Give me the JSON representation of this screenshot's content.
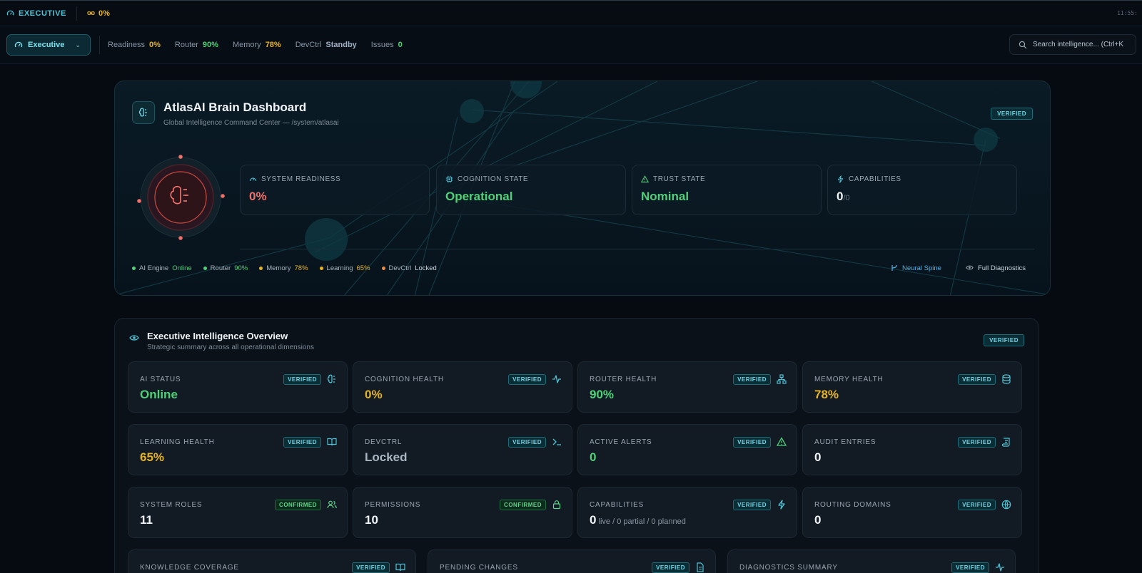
{
  "topbar": {
    "brand": "EXECUTIVE",
    "readiness": "0%",
    "clock": "11:55:"
  },
  "toolbar": {
    "mode_label": "Executive",
    "stats": [
      {
        "label": "Readiness",
        "value": "0%",
        "color": "#e6b422"
      },
      {
        "label": "Router",
        "value": "90%",
        "color": "#4fd17a"
      },
      {
        "label": "Memory",
        "value": "78%",
        "color": "#e6b422"
      },
      {
        "label": "DevCtrl",
        "value": "Standby",
        "color": "#9fb0c4"
      },
      {
        "label": "Issues",
        "value": "0",
        "color": "#4fd17a"
      }
    ],
    "search_placeholder": "Search intelligence... (Ctrl+K"
  },
  "hero": {
    "title": "AtlasAI Brain Dashboard",
    "subtitle": "Global Intelligence Command Center — /system/atlasai",
    "badge": "VERIFIED",
    "cards": [
      {
        "label": "SYSTEM READINESS",
        "value": "0%",
        "suffix": "",
        "color": "#f0706a",
        "icon": "gauge-icon"
      },
      {
        "label": "COGNITION STATE",
        "value": "Operational",
        "suffix": "",
        "color": "#4fd17a",
        "icon": "cpu-icon"
      },
      {
        "label": "TRUST STATE",
        "value": "Nominal",
        "suffix": "",
        "color": "#4fd17a",
        "icon": "warning-icon"
      },
      {
        "label": "CAPABILITIES",
        "value": "0",
        "suffix": "/0",
        "color": "#f2f6fa",
        "icon": "bolt-icon"
      }
    ],
    "status": [
      {
        "label": "AI Engine",
        "value": "Online",
        "dot": "#4fd17a",
        "color": "#4fd17a"
      },
      {
        "label": "Router",
        "value": "90%",
        "dot": "#4fd17a",
        "color": "#4fd17a"
      },
      {
        "label": "Memory",
        "value": "78%",
        "dot": "#e6b422",
        "color": "#e6b422"
      },
      {
        "label": "Learning",
        "value": "65%",
        "dot": "#e6b422",
        "color": "#e6b422"
      },
      {
        "label": "DevCtrl",
        "value": "Locked",
        "dot": "#f08a3a",
        "color": "#c9d4e0"
      }
    ],
    "links": {
      "neural": "Neural Spine",
      "diagnostics": "Full Diagnostics"
    }
  },
  "overview": {
    "title": "Executive Intelligence Overview",
    "subtitle": "Strategic summary across all operational dimensions",
    "badge": "VERIFIED",
    "tiles": [
      {
        "label": "AI STATUS",
        "value": "Online",
        "extra": "",
        "color": "#4fd17a",
        "badge": "VERIFIED",
        "conf": false,
        "icon": "brain-icon"
      },
      {
        "label": "COGNITION HEALTH",
        "value": "0%",
        "extra": "",
        "color": "#e6b422",
        "badge": "VERIFIED",
        "conf": false,
        "icon": "activity-icon"
      },
      {
        "label": "ROUTER HEALTH",
        "value": "90%",
        "extra": "",
        "color": "#4fd17a",
        "badge": "VERIFIED",
        "conf": false,
        "icon": "network-icon"
      },
      {
        "label": "MEMORY HEALTH",
        "value": "78%",
        "extra": "",
        "color": "#e6b422",
        "badge": "VERIFIED",
        "conf": false,
        "icon": "database-icon"
      },
      {
        "label": "LEARNING HEALTH",
        "value": "65%",
        "extra": "",
        "color": "#e6b422",
        "badge": "VERIFIED",
        "conf": false,
        "icon": "book-icon"
      },
      {
        "label": "DEVCTRL",
        "value": "Locked",
        "extra": "",
        "color": "#aab6c2",
        "badge": "VERIFIED",
        "conf": false,
        "icon": "terminal-icon"
      },
      {
        "label": "ACTIVE ALERTS",
        "value": "0",
        "extra": "",
        "color": "#4fd17a",
        "badge": "VERIFIED",
        "conf": false,
        "icon": "warning-icon"
      },
      {
        "label": "AUDIT ENTRIES",
        "value": "0",
        "extra": "",
        "color": "#f2f6fa",
        "badge": "VERIFIED",
        "conf": false,
        "icon": "scroll-icon"
      },
      {
        "label": "SYSTEM ROLES",
        "value": "11",
        "extra": "",
        "color": "#f2f6fa",
        "badge": "CONFIRMED",
        "conf": true,
        "icon": "users-icon"
      },
      {
        "label": "PERMISSIONS",
        "value": "10",
        "extra": "",
        "color": "#f2f6fa",
        "badge": "CONFIRMED",
        "conf": true,
        "icon": "lock-icon"
      },
      {
        "label": "CAPABILITIES",
        "value": "0",
        "extra": " live / 0 partial / 0 planned",
        "color": "#f2f6fa",
        "badge": "VERIFIED",
        "conf": false,
        "icon": "bolt-icon"
      },
      {
        "label": "ROUTING DOMAINS",
        "value": "0",
        "extra": "",
        "color": "#f2f6fa",
        "badge": "VERIFIED",
        "conf": false,
        "icon": "globe-icon"
      }
    ],
    "bottom_tiles": [
      {
        "label": "KNOWLEDGE COVERAGE",
        "badge": "VERIFIED",
        "icon": "book-icon"
      },
      {
        "label": "PENDING CHANGES",
        "badge": "VERIFIED",
        "icon": "file-icon"
      },
      {
        "label": "DIAGNOSTICS SUMMARY",
        "badge": "VERIFIED",
        "icon": "activity-icon"
      }
    ]
  }
}
